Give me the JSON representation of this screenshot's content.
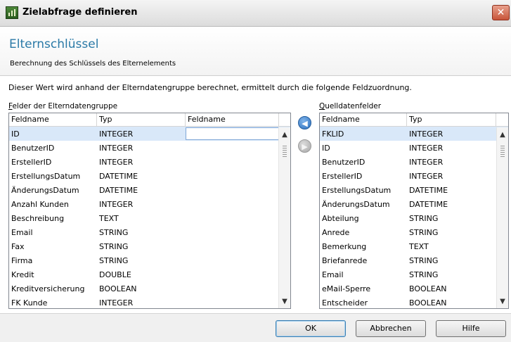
{
  "window": {
    "title": "Zielabfrage definieren",
    "close_symbol": "✕"
  },
  "header": {
    "title": "Elternschlüssel",
    "subtitle": "Berechnung des Schlüssels des Elternelements"
  },
  "description": "Dieser Wert wird anhand der Elterndatengruppe berechnet, ermittelt durch die folgende Feldzuordnung.",
  "left_group": {
    "label_accel": "F",
    "label_rest": "elder der Elterndatengruppe",
    "columns": [
      "Feldname",
      "Typ",
      "Feldname"
    ],
    "rows": [
      [
        "ID",
        "INTEGER",
        ""
      ],
      [
        "BenutzerID",
        "INTEGER",
        ""
      ],
      [
        "ErstellerID",
        "INTEGER",
        ""
      ],
      [
        "ErstellungsDatum",
        "DATETIME",
        ""
      ],
      [
        "ÄnderungsDatum",
        "DATETIME",
        ""
      ],
      [
        "Anzahl Kunden",
        "INTEGER",
        ""
      ],
      [
        "Beschreibung",
        "TEXT",
        ""
      ],
      [
        "Email",
        "STRING",
        ""
      ],
      [
        "Fax",
        "STRING",
        ""
      ],
      [
        "Firma",
        "STRING",
        ""
      ],
      [
        "Kredit",
        "DOUBLE",
        ""
      ],
      [
        "Kreditversicherung",
        "BOOLEAN",
        ""
      ],
      [
        "FK Kunde",
        "INTEGER",
        ""
      ]
    ]
  },
  "right_group": {
    "label_accel": "Q",
    "label_rest": "uelldatenfelder",
    "columns": [
      "Feldname",
      "Typ"
    ],
    "rows": [
      [
        "FKLID",
        "INTEGER"
      ],
      [
        "ID",
        "INTEGER"
      ],
      [
        "BenutzerID",
        "INTEGER"
      ],
      [
        "ErstellerID",
        "INTEGER"
      ],
      [
        "ErstellungsDatum",
        "DATETIME"
      ],
      [
        "ÄnderungsDatum",
        "DATETIME"
      ],
      [
        "Abteilung",
        "STRING"
      ],
      [
        "Anrede",
        "STRING"
      ],
      [
        "Bemerkung",
        "TEXT"
      ],
      [
        "Briefanrede",
        "STRING"
      ],
      [
        "Email",
        "STRING"
      ],
      [
        "eMail-Sperre",
        "BOOLEAN"
      ],
      [
        "Entscheider",
        "BOOLEAN"
      ]
    ]
  },
  "move_buttons": {
    "left_icon": "arrow-left-icon",
    "right_icon": "arrow-right-icon"
  },
  "buttons": {
    "ok": "OK",
    "cancel": "Abbrechen",
    "help": "Hilfe"
  },
  "colors": {
    "header_title": "#2b7aa7",
    "selection": "#d9e8f9"
  }
}
